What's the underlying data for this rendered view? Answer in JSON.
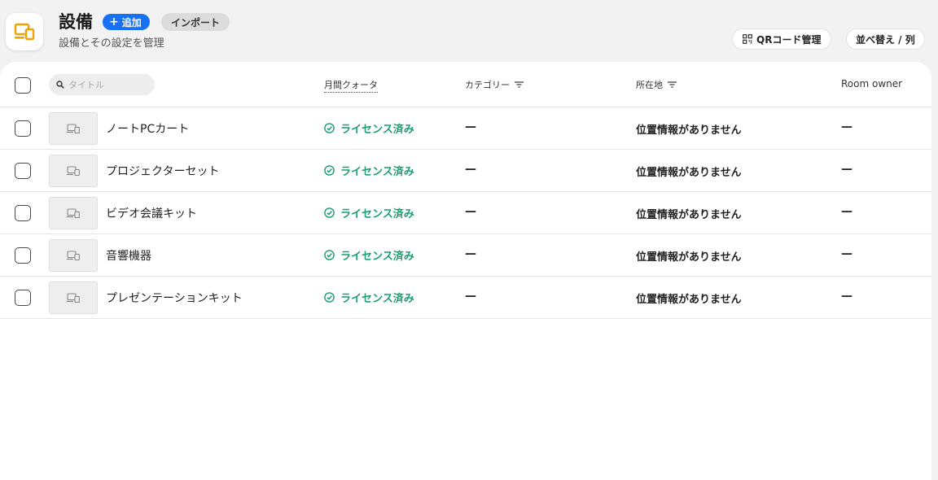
{
  "header": {
    "title": "設備",
    "add_label": "追加",
    "import_label": "インポート",
    "subtitle": "設備とその設定を管理",
    "qr_label": "QRコード管理",
    "sort_label": "並べ替え / 列",
    "accent": "#1671f5",
    "app_icon_color": "#f0a202"
  },
  "table": {
    "search_placeholder": "タイトル",
    "columns": {
      "quota": "月間クォータ",
      "category": "カテゴリー",
      "location": "所在地",
      "owner": "Room owner"
    },
    "rows": [
      {
        "name": "ノートPCカート",
        "license": "ライセンス済み",
        "category": "—",
        "location": "位置情報がありません",
        "owner": "—"
      },
      {
        "name": "プロジェクターセット",
        "license": "ライセンス済み",
        "category": "—",
        "location": "位置情報がありません",
        "owner": "—"
      },
      {
        "name": "ビデオ会議キット",
        "license": "ライセンス済み",
        "category": "—",
        "location": "位置情報がありません",
        "owner": "—"
      },
      {
        "name": "音響機器",
        "license": "ライセンス済み",
        "category": "—",
        "location": "位置情報がありません",
        "owner": "—"
      },
      {
        "name": "プレゼンテーションキット",
        "license": "ライセンス済み",
        "category": "—",
        "location": "位置情報がありません",
        "owner": "—"
      }
    ],
    "license_color": "#1a9e74"
  }
}
